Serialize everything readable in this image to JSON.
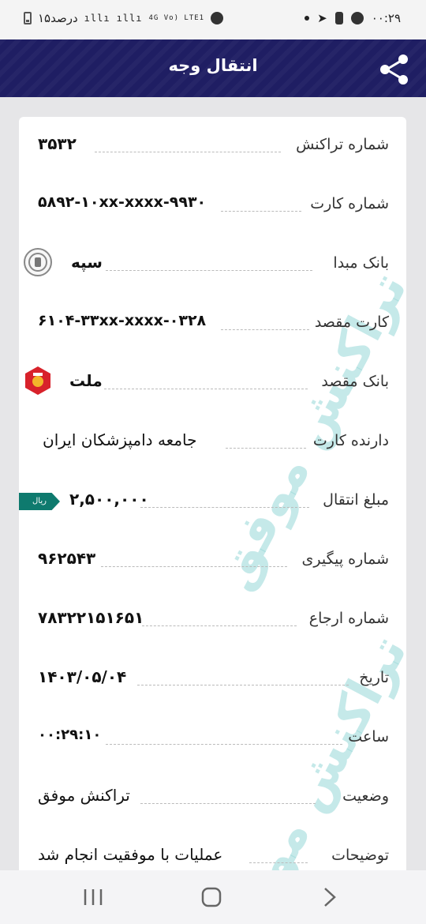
{
  "status_bar": {
    "time": "۰۰:۲۹",
    "battery_text": "۱۵درصد",
    "network": "4G Vo) LTE1"
  },
  "header": {
    "title": "انتقال وجه",
    "share_icon": "share-icon"
  },
  "receipt": {
    "rows": [
      {
        "label": "شماره تراکنش",
        "value": "۳۵۳۲"
      },
      {
        "label": "شماره کارت",
        "value": "۵۸۹۲-۱۰xx-xxxx-۹۹۳۰"
      },
      {
        "label": "بانک مبدا",
        "value": "سپه"
      },
      {
        "label": "کارت مقصد",
        "value": "۶۱۰۴-۳۳xx-xxxx-۰۳۲۸"
      },
      {
        "label": "بانک مقصد",
        "value": "ملت"
      },
      {
        "label": "دارنده کارت",
        "value": "جامعه دامپزشکان ایران"
      },
      {
        "label": "مبلغ انتقال",
        "value": "۲,۵۰۰,۰۰۰"
      },
      {
        "label": "شماره پیگیری",
        "value": "۹۶۲۵۴۳"
      },
      {
        "label": "شماره ارجاع",
        "value": "۷۸۳۲۲۱۵۱۶۵۱"
      },
      {
        "label": "تاریخ",
        "value": "۱۴۰۳/۰۵/۰۴"
      },
      {
        "label": "ساعت",
        "value": "۰۰:۲۹:۱۰"
      },
      {
        "label": "وضعیت",
        "value": "تراکنش موفق"
      },
      {
        "label": "توضیحات",
        "value": "عملیات با موفقیت انجام شد"
      }
    ],
    "currency_badge": "ریال",
    "source_bank_logo": "sepah-bank-logo",
    "dest_bank_logo": "mellat-bank-logo"
  },
  "watermark": "تراکنش موفق",
  "nav": {
    "recent_icon": "recent-apps-icon",
    "home_icon": "home-icon",
    "back_icon": "back-icon"
  },
  "colors": {
    "app_bar": "#1f1e63",
    "badge": "#0e7a6e",
    "watermark": "#96d7d7"
  }
}
